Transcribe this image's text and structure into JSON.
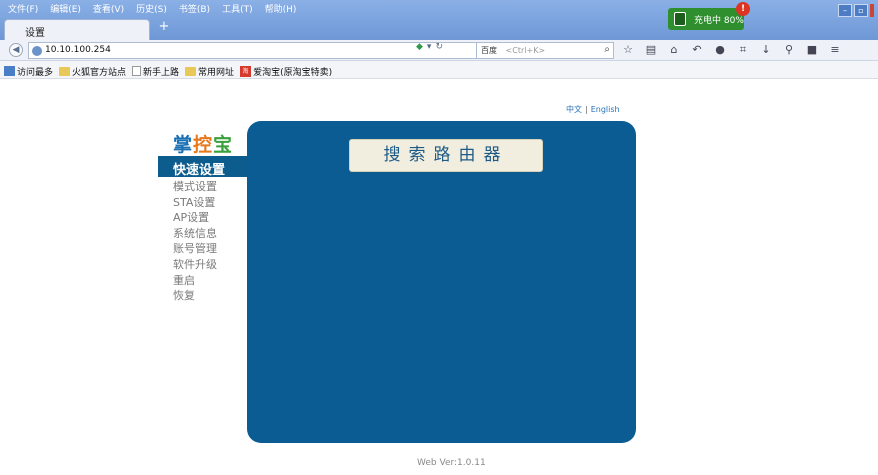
{
  "browser": {
    "menu": [
      "文件(F)",
      "编辑(E)",
      "查看(V)",
      "历史(S)",
      "书签(B)",
      "工具(T)",
      "帮助(H)"
    ],
    "tab_title": "设置",
    "new_tab_label": "+",
    "charging_text": "充电中 80%",
    "charging_alert": "!",
    "url": "10.10.100.254",
    "search_engine": "百度",
    "search_placeholder": "<Ctrl+K>",
    "bookmarks": [
      "访问最多",
      "火狐官方站点",
      "新手上路",
      "常用网址",
      "爱淘宝(原淘宝特卖)"
    ],
    "bookmark_badge": "淘"
  },
  "page": {
    "lang_cn": "中文",
    "lang_sep": "|",
    "lang_en": "English",
    "brand_1": "掌",
    "brand_2": "控",
    "brand_3": "宝",
    "nav_active": "快速设置",
    "nav_items": [
      "模式设置",
      "STA设置",
      "AP设置",
      "系统信息",
      "账号管理",
      "软件升级",
      "重启",
      "恢复"
    ],
    "search_router_label": "搜索路由器",
    "version": "Web Ver:1.0.11"
  },
  "colors": {
    "panel": "#0a5c92",
    "nav_active_bg": "#0d5c8e",
    "brand_blue": "#1a6fb2",
    "brand_orange": "#e5781d",
    "brand_green": "#3aa03c"
  }
}
